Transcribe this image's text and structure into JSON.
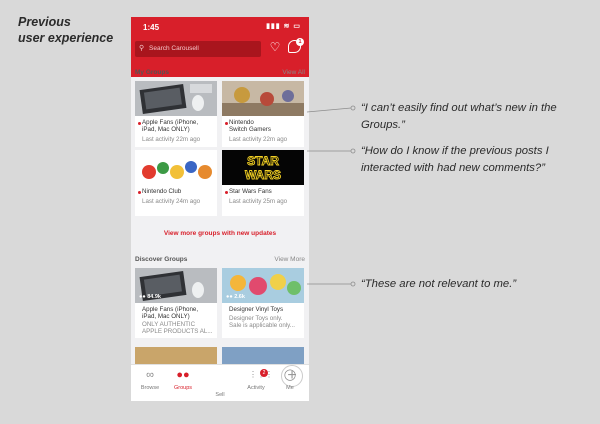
{
  "slide_title": [
    "Previous",
    "user experience"
  ],
  "status": {
    "time": "1:45",
    "icons": "▮▮▮ ≋ ▭"
  },
  "search": {
    "placeholder": "Search Carousell",
    "chat_badge": "1"
  },
  "my_groups": {
    "title": "My Groups",
    "link": "View All",
    "cards": [
      {
        "lines": [
          "Apple Fans (iPhone,",
          "iPad, Mac ONLY)"
        ],
        "meta": "Last activity 22m ago"
      },
      {
        "lines": [
          "Nintendo",
          "Switch Gamers"
        ],
        "meta": "Last activity 22m ago"
      },
      {
        "lines": [
          "Nintendo Club"
        ],
        "meta": "Last activity 24m ago"
      },
      {
        "lines": [
          "Star Wars Fans"
        ],
        "meta": "Last activity 25m ago"
      }
    ],
    "star_wars_logo": [
      "STAR",
      "WARS"
    ]
  },
  "view_more": "View more groups with new updates",
  "discover": {
    "title": "Discover Groups",
    "link": "View More",
    "cards": [
      {
        "members": "84.9k",
        "name": [
          "Apple Fans (iPhone,",
          "iPad, Mac ONLY)"
        ],
        "desc": [
          "ONLY AUTHENTIC",
          "APPLE PRODUCTS AL..."
        ]
      },
      {
        "members": "2.6k",
        "name": [
          "Designer Vinyl Toys"
        ],
        "desc": [
          "Designer Toys only.",
          "Sale is applicable only..."
        ]
      }
    ]
  },
  "tabs": [
    {
      "label": "Browse",
      "icon": "glasses-icon"
    },
    {
      "label": "Groups",
      "icon": "people-icon"
    },
    {
      "label": "Sell",
      "icon": "plus-icon"
    },
    {
      "label": "Activity",
      "icon": "grid-icon",
      "badge": "2"
    },
    {
      "label": "Me",
      "icon": "person-icon"
    }
  ],
  "callouts": [
    [
      "“I can’t easily find out what’s new in the",
      "Groups.”"
    ],
    [
      "“How do I know if the previous posts I",
      "interacted with had new comments?”"
    ],
    [
      "“These are not relevant to me.”"
    ]
  ],
  "colors": {
    "brand": "#d81f2a",
    "background": "#d9d9d9"
  }
}
